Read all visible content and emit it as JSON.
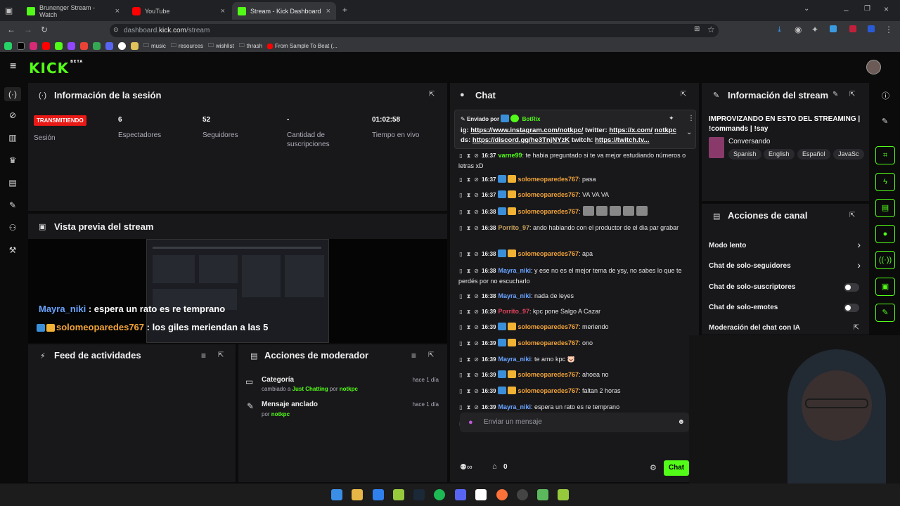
{
  "browser": {
    "tabs": [
      {
        "title": "Brunenger Stream - Watch",
        "icon": "kick-favicon"
      },
      {
        "title": "YouTube",
        "icon": "youtube-favicon"
      },
      {
        "title": "Stream - Kick Dashboard",
        "icon": "kick-favicon"
      }
    ],
    "url_prefix": "dashboard.",
    "url_domain": "kick.com",
    "url_path": "/stream",
    "bookmarks": [
      "music",
      "resources",
      "wishlist",
      "thrash",
      "From Sample To Beat (..."
    ]
  },
  "app": {
    "logo": "KICK",
    "logo_sup": "BETA"
  },
  "session": {
    "title": "Información de la sesión",
    "live_badge": "TRANSMITIENDO",
    "live_label": "Sesión",
    "stats": [
      {
        "value": "6",
        "label": "Espectadores"
      },
      {
        "value": "52",
        "label": "Seguidores"
      },
      {
        "value": "-",
        "label": "Cantidad de suscripciones"
      },
      {
        "value": "01:02:58",
        "label": "Tiempo en vivo"
      }
    ]
  },
  "preview": {
    "title": "Vista previa del stream",
    "overlay_line1_user": "Mayra_niki",
    "overlay_line1_text": " : espera un rato es re temprano",
    "overlay_line2_user": "solomeoparedes767",
    "overlay_line2_text": " : los giles meriendan a las 5"
  },
  "feed": {
    "title": "Feed de actividades"
  },
  "mod_actions": {
    "title": "Acciones de moderador",
    "items": [
      {
        "title": "Categoría",
        "sub_prefix": "cambiado a ",
        "sub_highlight": "Just Chatting",
        "sub_mid": " por ",
        "sub_user": "notkpc",
        "time": "hace 1 día"
      },
      {
        "title": "Mensaje anclado",
        "sub_prefix": "por ",
        "sub_user": "notkpc",
        "time": "hace 1 día"
      }
    ]
  },
  "chat": {
    "title": "Chat",
    "pinned": {
      "sent_by": "Enviado por",
      "bot": "BotRix",
      "ig_label": "ig:",
      "ig_link": "https://www.instagram.com/notkpc/",
      "twitter_label": " twitter: ",
      "twitter_link": "https://x.com/",
      "user": "notkpc",
      "ds_label": " ds: ",
      "ds_link": "https://discord.gg/he3TnjNYzK",
      "twitch_label": " twitch: ",
      "twitch_link": "https://twitch.tv..."
    },
    "messages": [
      {
        "time": "16:37",
        "user": "varne99",
        "color": "green",
        "badges": 0,
        "text": ": te habia preguntado si te va mejor estudiando números o letras xD"
      },
      {
        "time": "16:37",
        "user": "solomeoparedes767",
        "color": "orange",
        "badges": 2,
        "text": ": pasa"
      },
      {
        "time": "16:37",
        "user": "solomeoparedes767",
        "color": "orange",
        "badges": 2,
        "text": ": VA VA VA"
      },
      {
        "time": "16:38",
        "user": "solomeoparedes767",
        "color": "orange",
        "badges": 2,
        "text": ":",
        "emotes": 5
      },
      {
        "time": "16:38",
        "user": "Porrito_97",
        "color": "gold",
        "badges": 0,
        "text": ": ando hablando con el productor de el dia par grabar"
      },
      {
        "time": "16:38",
        "user": "solomeoparedes767",
        "color": "orange",
        "badges": 2,
        "text": ": apa"
      },
      {
        "time": "16:38",
        "user": "Mayra_niki",
        "color": "blue",
        "badges": 0,
        "text": ": y ese no es el mejor tema de ysy, no sabes lo que te perdés por no escucharlo"
      },
      {
        "time": "16:38",
        "user": "Mayra_niki",
        "color": "blue",
        "badges": 0,
        "text": ": nada de leyes"
      },
      {
        "time": "16:39",
        "user": "Porrito_97",
        "color": "red",
        "badges": 0,
        "text": ": kpc pone Salgo A Cazar"
      },
      {
        "time": "16:39",
        "user": "solomeoparedes767",
        "color": "orange",
        "badges": 2,
        "text": ": meriendo"
      },
      {
        "time": "16:39",
        "user": "solomeoparedes767",
        "color": "orange",
        "badges": 2,
        "text": ": ono"
      },
      {
        "time": "16:39",
        "user": "Mayra_niki",
        "color": "blue",
        "badges": 0,
        "text": ": te amo kpc 🐷"
      },
      {
        "time": "16:39",
        "user": "solomeoparedes767",
        "color": "orange",
        "badges": 2,
        "text": ": ahoea no"
      },
      {
        "time": "16:39",
        "user": "solomeoparedes767",
        "color": "orange",
        "badges": 2,
        "text": ": faltan 2 horas"
      },
      {
        "time": "16:39",
        "user": "Mayra_niki",
        "color": "blue",
        "badges": 0,
        "text": ": espera un rato es re temprano"
      },
      {
        "time": "16:39",
        "user": "solomeoparedes767",
        "color": "orange",
        "badges": 2,
        "text": ": los giles meriendan a las 5"
      }
    ],
    "input_placeholder": "Enviar un mensaje",
    "count": "0",
    "send_label": "Chat"
  },
  "stream_info": {
    "title": "Información del stream",
    "stream_title": "IMPROVIZANDO EN ESTO DEL STREAMING | !commands | !say",
    "category": "Conversando",
    "tags": [
      "Spanish",
      "English",
      "Español",
      "JavaSc"
    ]
  },
  "channel_actions": {
    "title": "Acciones de canal",
    "rows": [
      {
        "label": "Modo lento",
        "control": "chevron"
      },
      {
        "label": "Chat de solo-seguidores",
        "control": "chevron"
      },
      {
        "label": "Chat de solo-suscriptores",
        "control": "toggle"
      },
      {
        "label": "Chat de solo-emotes",
        "control": "toggle"
      },
      {
        "label": "Moderación del chat con IA",
        "control": "external"
      }
    ]
  },
  "colors": {
    "accent": "#53fc18",
    "live": "#e91916",
    "panel": "#18181b",
    "background": "#0b0b0c"
  }
}
